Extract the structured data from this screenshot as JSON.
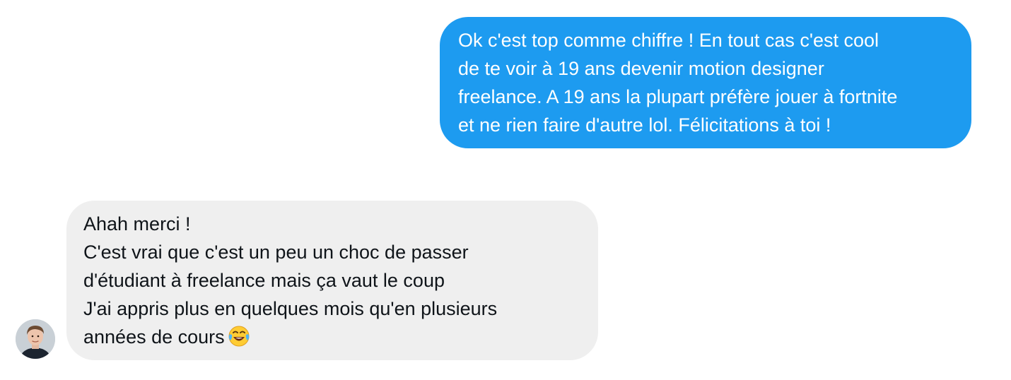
{
  "conversation": {
    "outgoing_message": {
      "lines": [
        "Ok c'est top comme chiffre ! En tout cas c'est cool",
        "de te voir à 19 ans devenir motion designer",
        "freelance. A 19 ans la plupart préfère jouer à fortnite",
        "et ne rien faire d'autre lol. Félicitations à toi !"
      ]
    },
    "incoming_message": {
      "lines": [
        "Ahah merci !",
        "C'est vrai que c'est un peu un choc de passer",
        "d'étudiant à freelance mais ça vaut le coup",
        "J'ai appris plus en quelques mois qu'en plusieurs",
        "années de cours"
      ],
      "emoji": "face-with-tears-of-joy-icon"
    },
    "colors": {
      "outgoing_bubble": "#1d9bf0",
      "outgoing_text": "#ffffff",
      "incoming_bubble": "#efefef",
      "incoming_text": "#0f1419"
    },
    "avatar_icon": "user-avatar"
  }
}
